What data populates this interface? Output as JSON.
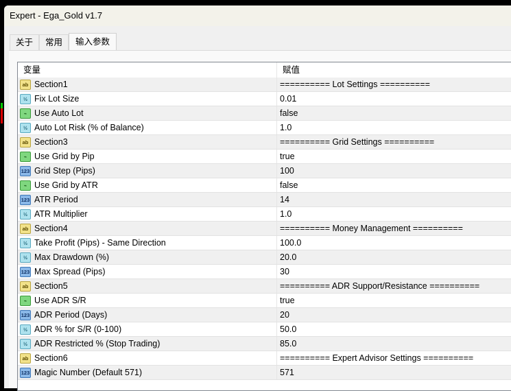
{
  "window": {
    "title": "Expert - Ega_Gold v1.7"
  },
  "tabs": [
    {
      "label": "关于"
    },
    {
      "label": "常用"
    },
    {
      "label": "输入参数"
    }
  ],
  "table": {
    "headers": {
      "variable": "变量",
      "value": "赋值"
    },
    "rows": [
      {
        "type": "string",
        "icon": "ab",
        "name": "Section1",
        "value": "========== Lot Settings =========="
      },
      {
        "type": "double",
        "icon": "½",
        "name": "Fix Lot Size",
        "value": "0.01"
      },
      {
        "type": "bool",
        "icon": "⌁",
        "name": "Use Auto Lot",
        "value": "false"
      },
      {
        "type": "double",
        "icon": "½",
        "name": "Auto Lot Risk (% of Balance)",
        "value": "1.0"
      },
      {
        "type": "string",
        "icon": "ab",
        "name": "Section3",
        "value": "========== Grid Settings =========="
      },
      {
        "type": "bool",
        "icon": "⌁",
        "name": "Use Grid by Pip",
        "value": "true"
      },
      {
        "type": "int",
        "icon": "123",
        "name": "Grid Step (Pips)",
        "value": "100"
      },
      {
        "type": "bool",
        "icon": "⌁",
        "name": "Use Grid by ATR",
        "value": "false"
      },
      {
        "type": "int",
        "icon": "123",
        "name": "ATR Period",
        "value": "14"
      },
      {
        "type": "double",
        "icon": "½",
        "name": "ATR Multiplier",
        "value": "1.0"
      },
      {
        "type": "string",
        "icon": "ab",
        "name": "Section4",
        "value": "========== Money Management =========="
      },
      {
        "type": "double",
        "icon": "½",
        "name": "Take Profit (Pips) - Same Direction",
        "value": "100.0"
      },
      {
        "type": "double",
        "icon": "½",
        "name": "Max Drawdown (%)",
        "value": "20.0"
      },
      {
        "type": "int",
        "icon": "123",
        "name": "Max Spread (Pips)",
        "value": "30"
      },
      {
        "type": "string",
        "icon": "ab",
        "name": "Section5",
        "value": "========== ADR Support/Resistance =========="
      },
      {
        "type": "bool",
        "icon": "⌁",
        "name": "Use ADR S/R",
        "value": "true"
      },
      {
        "type": "int",
        "icon": "123",
        "name": "ADR Period (Days)",
        "value": "20"
      },
      {
        "type": "double",
        "icon": "½",
        "name": "ADR % for S/R (0-100)",
        "value": "50.0"
      },
      {
        "type": "double",
        "icon": "½",
        "name": "ADR Restricted % (Stop Trading)",
        "value": "85.0"
      },
      {
        "type": "string",
        "icon": "ab",
        "name": "Section6",
        "value": "========== Expert Advisor Settings =========="
      },
      {
        "type": "int",
        "icon": "123",
        "name": "Magic Number (Default 571)",
        "value": "571"
      }
    ]
  }
}
